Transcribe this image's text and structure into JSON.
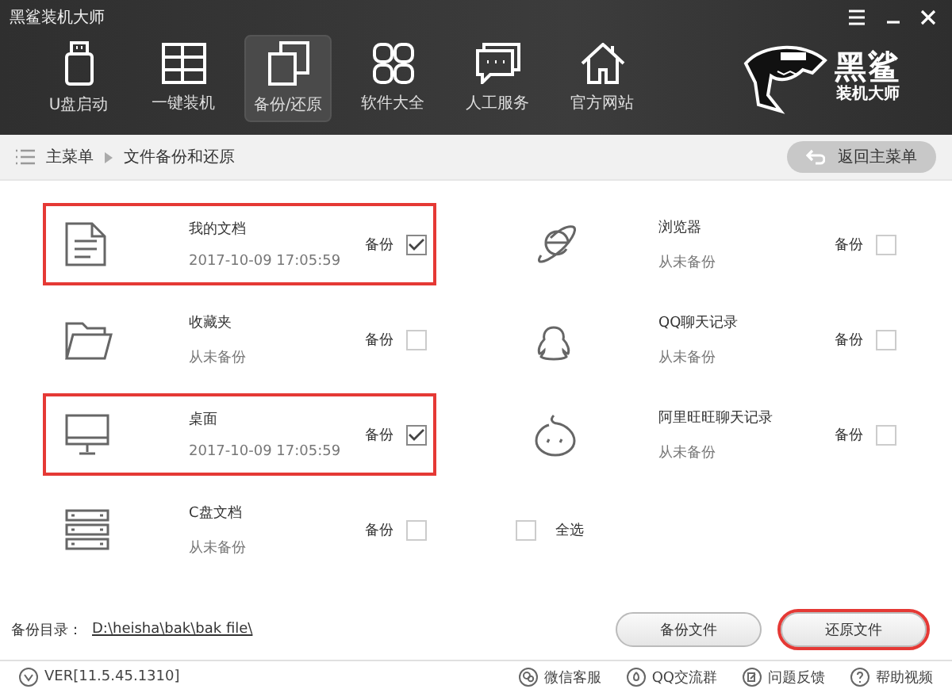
{
  "window": {
    "title": "黑鲨装机大师"
  },
  "nav": [
    {
      "kind": "usb",
      "label": "U盘启动",
      "selected": false
    },
    {
      "kind": "windows",
      "label": "一键装机",
      "selected": false
    },
    {
      "kind": "copy",
      "label": "备份/还原",
      "selected": true
    },
    {
      "kind": "grid",
      "label": "软件大全",
      "selected": false
    },
    {
      "kind": "chat",
      "label": "人工服务",
      "selected": false
    },
    {
      "kind": "home",
      "label": "官方网站",
      "selected": false
    }
  ],
  "logo": {
    "line1": "黑鲨",
    "line2": "装机大师"
  },
  "breadcrumb": {
    "items": [
      "主菜单",
      "文件备份和还原"
    ],
    "back_button": "返回主菜单"
  },
  "items": [
    {
      "kind": "document",
      "name": "我的文档",
      "status": "2017-10-09 17:05:59",
      "check_label": "备份",
      "checked": true,
      "highlighted": true
    },
    {
      "kind": "ie",
      "name": "浏览器",
      "status": "从未备份",
      "check_label": "备份",
      "checked": false,
      "highlighted": false
    },
    {
      "kind": "folder",
      "name": "收藏夹",
      "status": "从未备份",
      "check_label": "备份",
      "checked": false,
      "highlighted": false
    },
    {
      "kind": "qq",
      "name": "QQ聊天记录",
      "status": "从未备份",
      "check_label": "备份",
      "checked": false,
      "highlighted": false
    },
    {
      "kind": "monitor",
      "name": "桌面",
      "status": "2017-10-09 17:05:59",
      "check_label": "备份",
      "checked": true,
      "highlighted": true
    },
    {
      "kind": "wangwang",
      "name": "阿里旺旺聊天记录",
      "status": "从未备份",
      "check_label": "备份",
      "checked": false,
      "highlighted": false
    },
    {
      "kind": "server",
      "name": "C盘文档",
      "status": "从未备份",
      "check_label": "备份",
      "checked": false,
      "highlighted": false
    }
  ],
  "select_all": {
    "label": "全选",
    "checked": false
  },
  "backup_dir": {
    "label": "备份目录：",
    "path": "D:\\heisha\\bak\\bak file\\"
  },
  "buttons": [
    {
      "label": "备份文件",
      "highlighted": false
    },
    {
      "label": "还原文件",
      "highlighted": true
    }
  ],
  "footer": {
    "version": "VER[11.5.45.1310]",
    "links": [
      {
        "kind": "wechat",
        "label": "微信客服"
      },
      {
        "kind": "qq-group",
        "label": "QQ交流群"
      },
      {
        "kind": "feedback",
        "label": "问题反馈"
      },
      {
        "kind": "help",
        "label": "帮助视频"
      }
    ]
  }
}
